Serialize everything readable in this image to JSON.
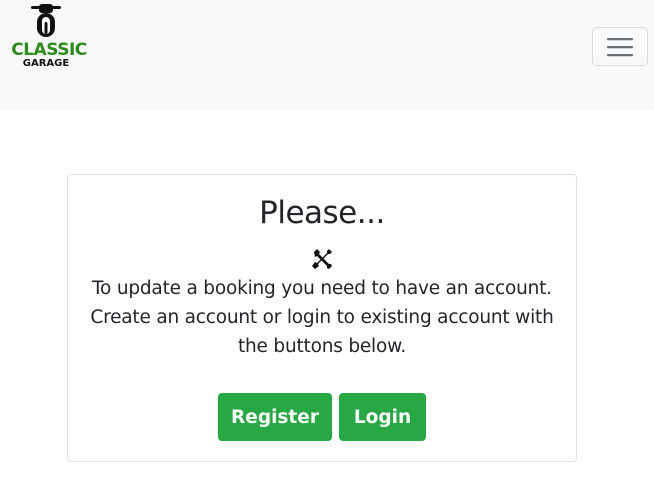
{
  "navbar": {
    "brand": {
      "line1": "CLASSIC",
      "line2": "GARAGE"
    }
  },
  "card": {
    "title": "Please...",
    "message": "To update a booking you need to have an account. Create an account or login to existing account with the buttons below.",
    "register_label": "Register",
    "login_label": "Login"
  },
  "colors": {
    "button": "#28a745",
    "brand_green": "#2e8b1c",
    "navbar_bg": "#f8f9fa"
  },
  "icons": [
    "motorcycle-logo-icon",
    "hamburger-menu-icon",
    "tools-icon"
  ]
}
